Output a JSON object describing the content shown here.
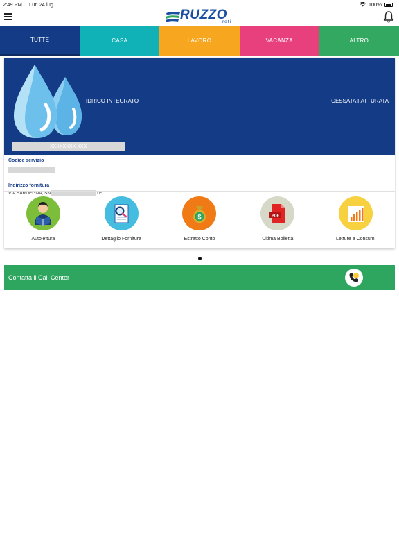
{
  "status_bar": {
    "time": "2:49 PM",
    "date": "Lun 24 lug",
    "battery": "100%"
  },
  "header": {
    "logo_main": "RUZZO",
    "logo_sub": "reti"
  },
  "tabs": [
    {
      "label": "TUTTE",
      "color": "#143b86",
      "active": true
    },
    {
      "label": "CASA",
      "color": "#11b1b8",
      "active": false
    },
    {
      "label": "LAVORO",
      "color": "#f6a61f",
      "active": false
    },
    {
      "label": "VACANZA",
      "color": "#e8407c",
      "active": false
    },
    {
      "label": "ALTRO",
      "color": "#33a860",
      "active": false
    }
  ],
  "service_card": {
    "type": "IDRICO INTEGRATO",
    "status": "CESSATA FATTURATA",
    "holder_name": "XXXXXXXX XXX",
    "code_label": "Codice servizio",
    "address_label": "Indirizzo fornitura",
    "address_prefix": "VIA SARDEGNA, SN",
    "address_suffix": "TE",
    "actions": [
      {
        "label": "Autolettura",
        "icon": "reader-icon",
        "color": "#7cbd3a"
      },
      {
        "label": "Dettaglio Fornitura",
        "icon": "document-search-icon",
        "color": "#45bde0"
      },
      {
        "label": "Estratto Conto",
        "icon": "money-bag-icon",
        "color": "#f07b16"
      },
      {
        "label": "Ultima Bolletta",
        "icon": "pdf-icon",
        "color": "#d6d8c8"
      },
      {
        "label": "Letture e Consumi",
        "icon": "bar-chart-icon",
        "color": "#f8d140"
      }
    ]
  },
  "call_center": {
    "label": "Contatta il Call Center",
    "icon": "phone-icon"
  }
}
